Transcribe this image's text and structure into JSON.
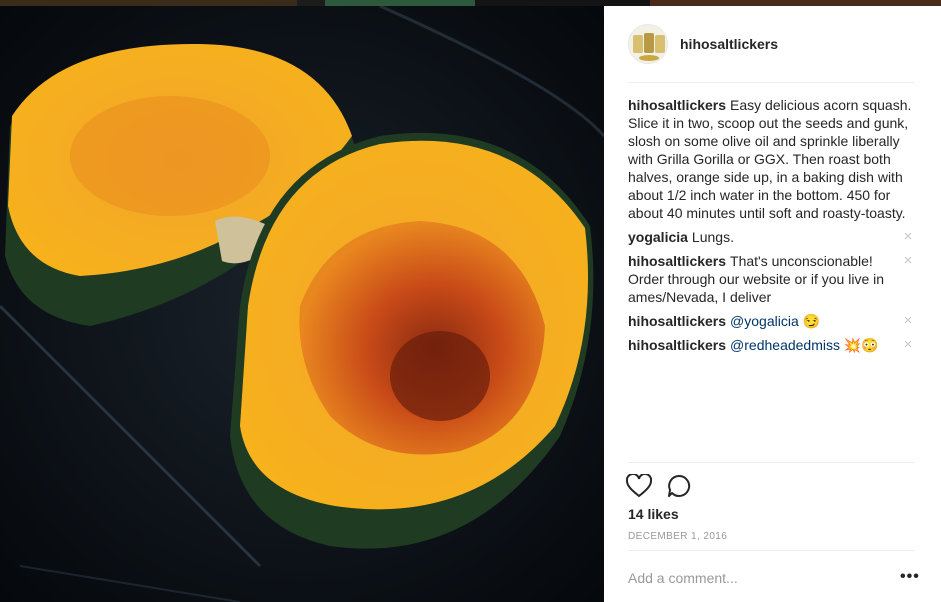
{
  "post": {
    "username": "hihosaltlickers",
    "caption": "Easy delicious acorn squash. Slice it in two, scoop out the seeds and gunk, slosh on some olive oil and sprinkle liberally with Grilla Gorilla or GGX. Then roast both halves, orange side up, in a baking dish with about 1/2 inch water in the bottom. 450 for about 40 minutes until soft and roasty-toasty.",
    "likes": "14 likes",
    "date": "DECEMBER 1, 2016",
    "add_comment_placeholder": "Add a comment...",
    "more_label": "•••",
    "delete_glyph": "×"
  },
  "comments": [
    {
      "username": "yogalicia",
      "mention": "",
      "text": "Lungs."
    },
    {
      "username": "hihosaltlickers",
      "mention": "",
      "text": "That's unconscionable! Order through our website or if you live in ames/Nevada, I deliver"
    },
    {
      "username": "hihosaltlickers",
      "mention": "@yogalicia",
      "text": " 😏"
    },
    {
      "username": "hihosaltlickers",
      "mention": "@redheadedmiss",
      "text": " 💥😳"
    }
  ],
  "icons": {
    "like": "heart-icon",
    "comment": "comment-bubble-icon",
    "more": "more-options-icon"
  },
  "colors": {
    "text": "#262626",
    "secondary": "#999999",
    "mention": "#003569",
    "divider": "#efefef"
  }
}
